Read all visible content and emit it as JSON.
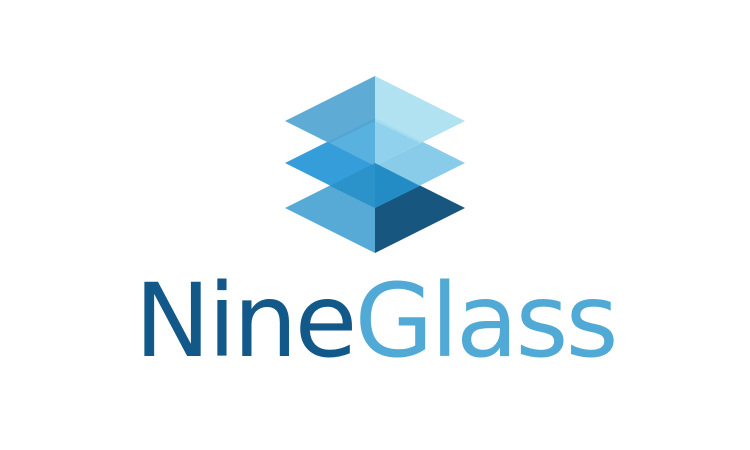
{
  "brand": {
    "name_part1": "Nine",
    "name_part2": "Glass",
    "mark_icon": "stacked-glass-layers-icon"
  },
  "colors": {
    "dark_blue": "#12598a",
    "light_blue": "#51a9d5",
    "layer_top_left": "#55a7d3",
    "layer_top_right": "#a8dff0",
    "layer_mid_left": "#2b98d9",
    "layer_mid_right": "#7ec8e8",
    "layer_bottom_left": "#57aad6",
    "layer_bottom_right": "#16567f"
  }
}
